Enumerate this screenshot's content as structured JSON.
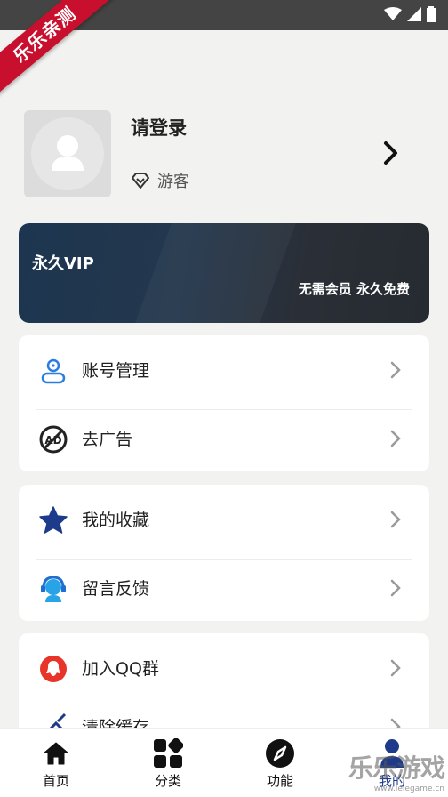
{
  "ribbon": "乐乐亲测",
  "profile": {
    "title": "请登录",
    "role": "游客"
  },
  "vip": {
    "title": "永久VIP",
    "subtitle": "无需会员 永久免费"
  },
  "menu_group_1": [
    {
      "label": "账号管理",
      "icon": "user-account-icon"
    },
    {
      "label": "去广告",
      "icon": "no-ad-icon"
    }
  ],
  "menu_group_2": [
    {
      "label": "我的收藏",
      "icon": "star-icon"
    },
    {
      "label": "留言反馈",
      "icon": "headset-support-icon"
    }
  ],
  "menu_group_3": [
    {
      "label": "加入QQ群",
      "icon": "qq-icon"
    },
    {
      "label": "清除缓存",
      "icon": "broom-icon"
    }
  ],
  "tabs": [
    {
      "label": "首页",
      "icon": "home-icon"
    },
    {
      "label": "分类",
      "icon": "category-grid-icon"
    },
    {
      "label": "功能",
      "icon": "compass-icon"
    },
    {
      "label": "我的",
      "icon": "profile-icon"
    }
  ],
  "watermark": {
    "main": "乐乐游戏",
    "url": "www.lelegame.cn"
  },
  "colors": {
    "accent": "#1e3a8a",
    "vip_dark": "#1d3550",
    "qq_red": "#e8352a",
    "support_blue": "#2196f3"
  }
}
